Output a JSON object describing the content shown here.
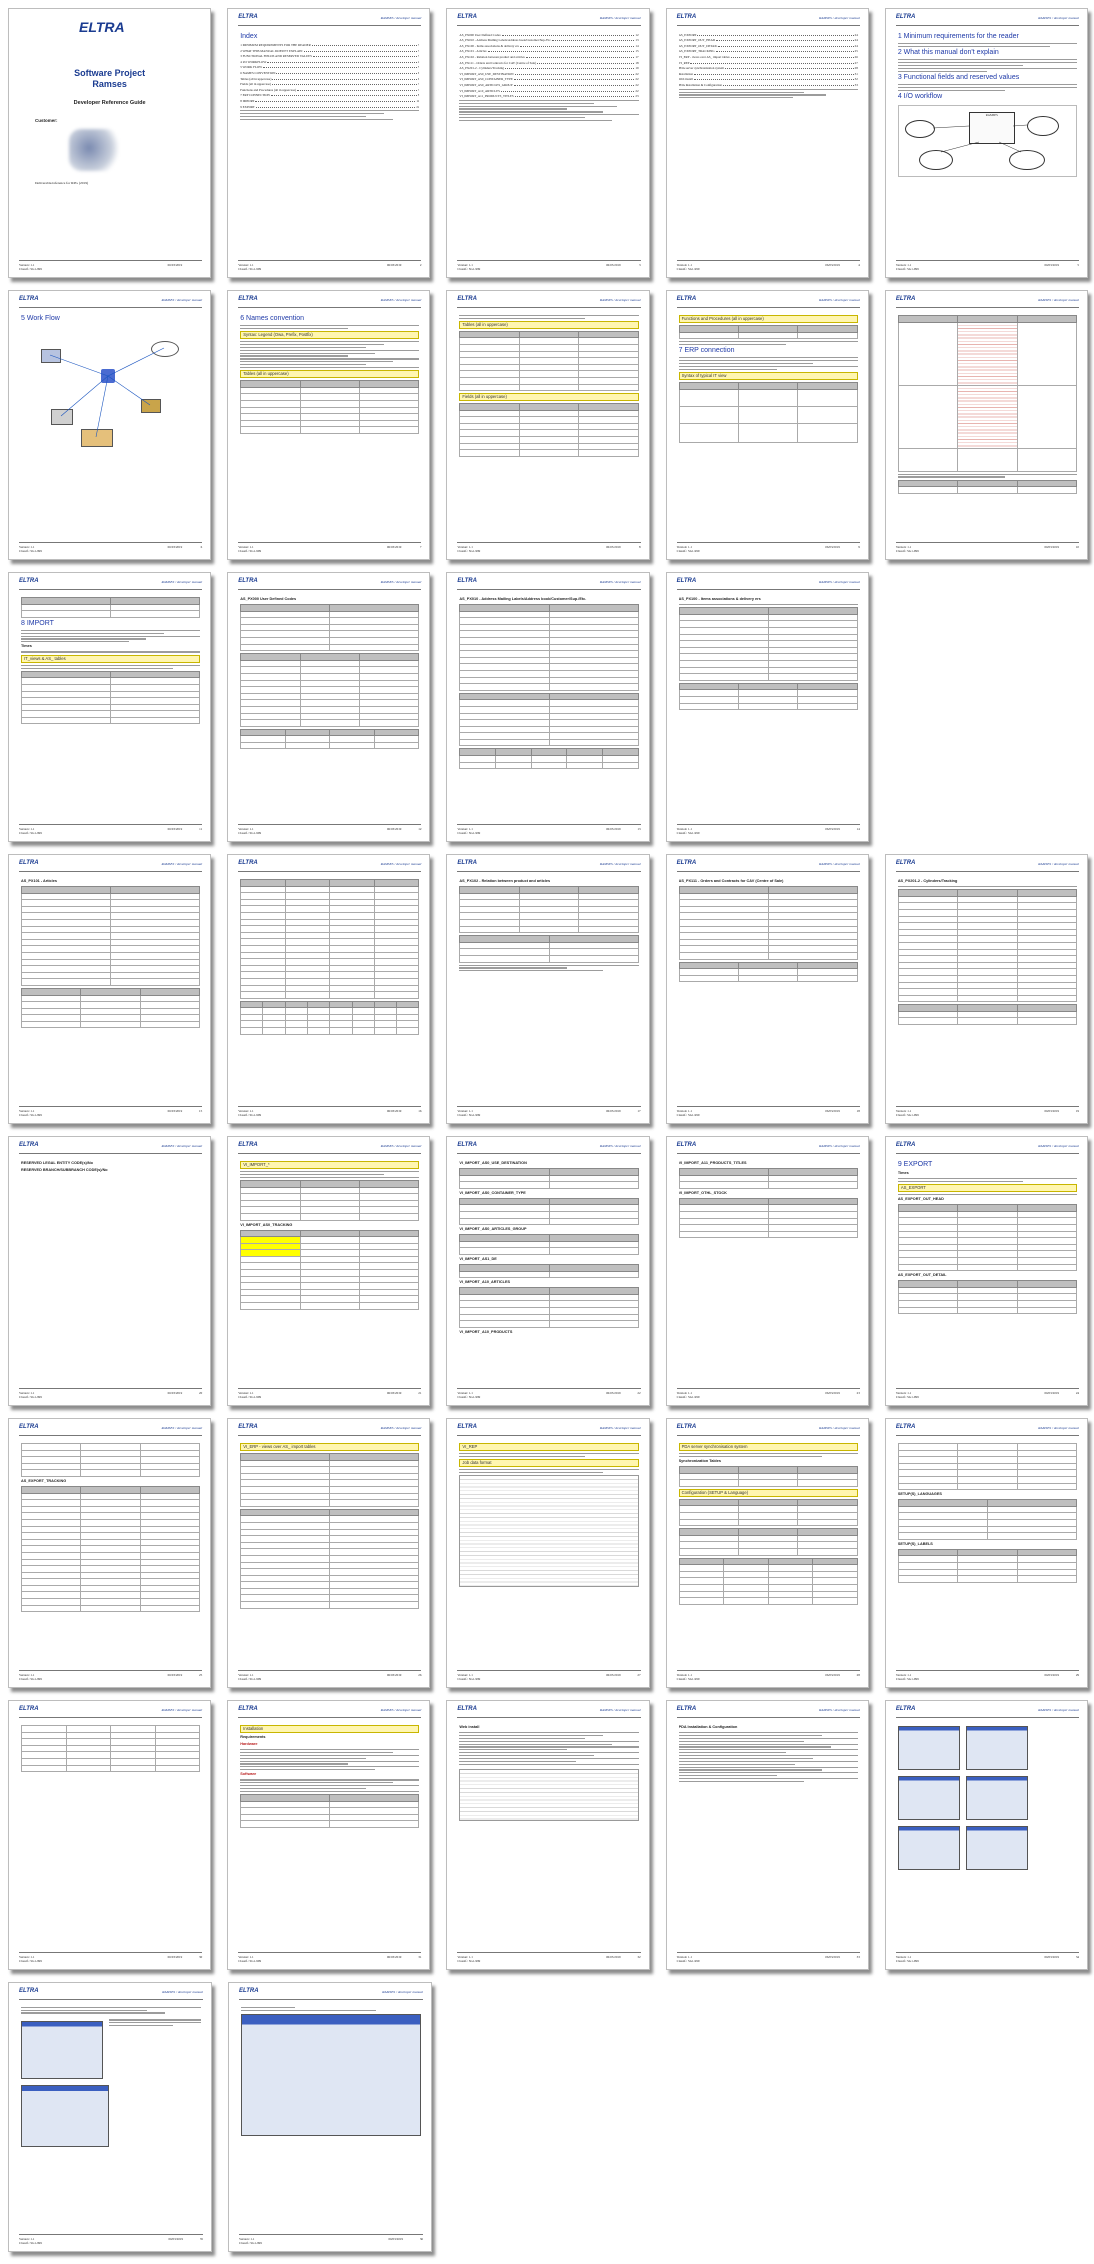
{
  "doc": {
    "logo": "ELTRA",
    "header": "RAMSES / developer manual",
    "version": "Version: 1.1",
    "classification": "Classif.: SG1-999",
    "date": "06/03/2019"
  },
  "cover": {
    "title_line1": "Software Project",
    "title_line2": "Ramses",
    "subtitle": "Developer Reference Guide",
    "customer_label": "Customer:",
    "footnote": "Deliverable/reference for RPG (2019)"
  },
  "toc": {
    "title": "Index",
    "entries": [
      "1 MINIMUM REQUIREMENTS FOR THE READER",
      "2 WHAT THIS MANUAL DOESN'T EXPLAIN",
      "3 FUNCTIONAL FIELDS AND RESERVED VALUES",
      "4 I/O WORKFLOW",
      "5 WORK FLOW",
      "6 NAMES CONVENTION",
      "Tables (all in uppercase)",
      "Fields (all in uppercase)",
      "Functions and Procedures (all in uppercase)",
      "7 ERP CONNECTION",
      "8 IMPORT",
      "9 EXPORT",
      "Installation",
      "Web install",
      "PDA Installation & Configuration"
    ]
  },
  "sections": {
    "s1": "1 Minimum requirements for the reader",
    "s2": "2 What this manual don't explain",
    "s3": "3 Functional fields and reserved values",
    "s4": "4 I/O workflow",
    "s5": "5 Work Flow",
    "s6": "6 Names convention",
    "s7": "7 ERP connection",
    "s8": "8 IMPORT",
    "s9": "9 EXPORT"
  },
  "labels": {
    "syntax_legend": "Syntax: Legend (Owa, Prefix, Postfix)",
    "tables_upper": "Tables (all in uppercase)",
    "fields_upper": "Fields (all in uppercase)",
    "functions_upper": "Functions and Procedures (all in uppercase)",
    "syntax_typical": "Syntax of typical IT view",
    "import_views": "IT_views & AS_ tables",
    "times": "Times",
    "as_export": "AS_EXPORT",
    "vi_erp": "VI_ERP - views over AS_ import tables",
    "vi_rep": "VI_REP",
    "job_kernel": "Job data format",
    "pda_sync": "PDA server synchronisation system",
    "synch_tables": "Synchronization Tables",
    "config": "Configuration (SETUP & Language)",
    "installation": "Installation",
    "requirements": "Requirements",
    "hardware": "Hardware",
    "software": "Software",
    "web_install": "Web install",
    "pda_install": "PDA Installation & Configuration",
    "reserved_legal": "RESERVED LEGAL ENTITY CODE(s)/No",
    "reserved_branch": "RESERVED BRANCH/SUBBRANCH CODE(s)/No",
    "settings_languages": "SETUP(S)_LANGUAGES",
    "settings_labels": "SETUP(S)_LABELS",
    "as_tables": [
      "AS_PX000 User Defined Codes",
      "AS_PX010 - Address Mailing Labels/Address book/Customer/Sup./Etc.",
      "AS_PX100 - Items associations & delivery ers",
      "AS_PX101 - Articles",
      "AS_PX102 - Relation between product and articles",
      "AS_PX111 - Orders and Contracts for CAV (Centre of Sale)",
      "AS_PX201-2 - Cylinders/Tracking"
    ],
    "vi_import": [
      "VI_IMPORT_AS0_USE_DESTINATION",
      "VI_IMPORT_AS0_CONTAINER_TYPE",
      "VI_IMPORT_AS0_ARTICLES_GROUP",
      "VI_IMPORT_AS1_DE",
      "VI_IMPORT_A10_ARTICLES",
      "VI_IMPORT_A10_PRODUCTS",
      "VI_IMPORT_A11_PRODUCTS_TITLES",
      "VI_IMPORT_OTHL_STOCK",
      "VI_IMPORT_AS0_TRACKING"
    ],
    "as_export_tables": [
      "AS_EXPORT_OUT_HEAD",
      "AS_EXPORT_OUT_DETAIL",
      "AS_EXPORT_TRACKING"
    ],
    "diagram_nodes": [
      "RAMSES",
      "ERP",
      "PDA",
      "Web Server"
    ]
  }
}
